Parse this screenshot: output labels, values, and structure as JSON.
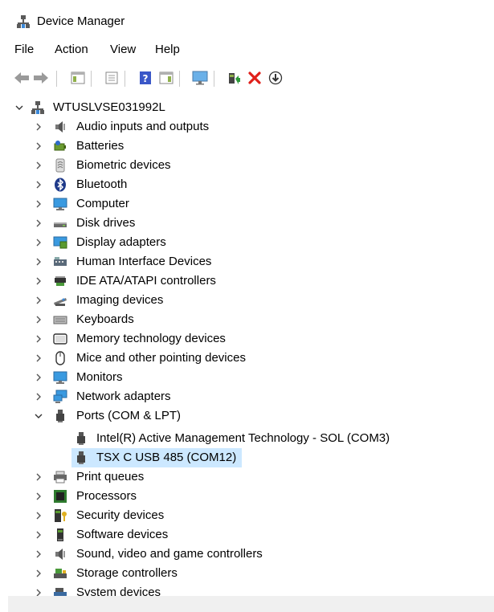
{
  "window": {
    "title": "Device Manager",
    "icon": "device-manager-icon"
  },
  "menu": [
    {
      "label": "File",
      "name": "menu-file"
    },
    {
      "label": "Action",
      "name": "menu-action"
    },
    {
      "label": "View",
      "name": "menu-view"
    },
    {
      "label": "Help",
      "name": "menu-help"
    }
  ],
  "toolbar": {
    "buttons": [
      {
        "name": "back-button",
        "icon": "arrow-left-icon"
      },
      {
        "name": "forward-button",
        "icon": "arrow-right-icon"
      },
      {
        "name": "console-tree-button",
        "icon": "console-tree-icon"
      },
      {
        "name": "properties-button",
        "icon": "properties-icon"
      },
      {
        "name": "help-button",
        "icon": "help-icon"
      },
      {
        "name": "action-pane-button",
        "icon": "action-pane-icon"
      },
      {
        "name": "scan-hardware-button",
        "icon": "monitor-scan-icon"
      },
      {
        "name": "update-driver-button",
        "icon": "update-driver-icon"
      },
      {
        "name": "uninstall-device-button",
        "icon": "red-x-icon"
      },
      {
        "name": "disable-device-button",
        "icon": "down-arrow-circle-icon"
      }
    ]
  },
  "tree": {
    "root": {
      "label": "WTUSLVSE031992L",
      "expanded": true,
      "icon": "computer-network-icon"
    },
    "items": [
      {
        "label": "Audio inputs and outputs",
        "icon": "speaker-icon"
      },
      {
        "label": "Batteries",
        "icon": "battery-icon"
      },
      {
        "label": "Biometric devices",
        "icon": "fingerprint-icon"
      },
      {
        "label": "Bluetooth",
        "icon": "bluetooth-icon"
      },
      {
        "label": "Computer",
        "icon": "computer-icon"
      },
      {
        "label": "Disk drives",
        "icon": "disk-drive-icon"
      },
      {
        "label": "Display adapters",
        "icon": "display-adapter-icon"
      },
      {
        "label": "Human Interface Devices",
        "icon": "hid-icon"
      },
      {
        "label": "IDE ATA/ATAPI controllers",
        "icon": "ide-controller-icon"
      },
      {
        "label": "Imaging devices",
        "icon": "camera-icon"
      },
      {
        "label": "Keyboards",
        "icon": "keyboard-icon"
      },
      {
        "label": "Memory technology devices",
        "icon": "memory-card-icon"
      },
      {
        "label": "Mice and other pointing devices",
        "icon": "mouse-icon"
      },
      {
        "label": "Monitors",
        "icon": "monitor-icon"
      },
      {
        "label": "Network adapters",
        "icon": "network-adapter-icon"
      },
      {
        "label": "Ports (COM & LPT)",
        "icon": "port-icon",
        "expanded": true,
        "children": [
          {
            "label": "Intel(R) Active Management Technology - SOL (COM3)",
            "icon": "port-icon"
          },
          {
            "label": "TSX C USB 485 (COM12)",
            "icon": "port-icon",
            "selected": true
          }
        ]
      },
      {
        "label": "Print queues",
        "icon": "printer-icon"
      },
      {
        "label": "Processors",
        "icon": "processor-icon"
      },
      {
        "label": "Security devices",
        "icon": "security-key-icon"
      },
      {
        "label": "Software devices",
        "icon": "software-device-icon"
      },
      {
        "label": "Sound, video and game controllers",
        "icon": "speaker-icon"
      },
      {
        "label": "Storage controllers",
        "icon": "storage-controller-icon"
      },
      {
        "label": "System devices",
        "icon": "system-devices-icon"
      }
    ]
  }
}
